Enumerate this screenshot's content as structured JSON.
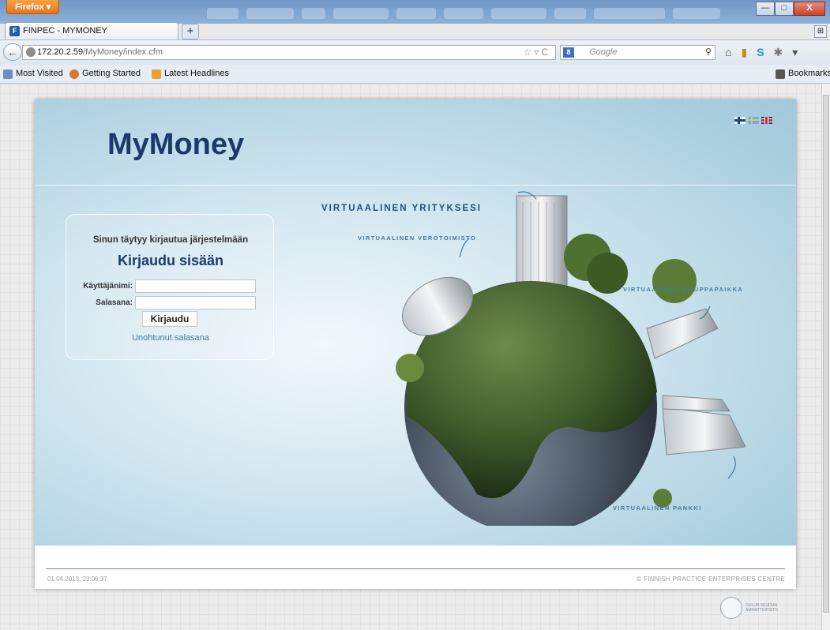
{
  "browser": {
    "app_menu": "Firefox",
    "tab_title": "FINPEC - MYMONEY",
    "tab_favicon": "F",
    "new_tab": "+",
    "url_host": "172.20.2.59",
    "url_path": "/MyMoney/index.cfm",
    "search_placeholder": "Google",
    "search_engine_icon": "8",
    "window_buttons": [
      "—",
      "□",
      "X"
    ],
    "bookmarks": [
      {
        "label": "Most Visited",
        "icon": "most-visited-icon",
        "color": "#6a8fc0"
      },
      {
        "label": "Getting Started",
        "icon": "firefox-icon",
        "color": "#e0762a"
      },
      {
        "label": "Latest Headlines",
        "icon": "rss-icon",
        "color": "#f0a030"
      }
    ],
    "bookmarks_menu": "Bookmarks"
  },
  "page": {
    "logo": "MyMoney",
    "languages": [
      "fi",
      "sv",
      "en"
    ],
    "login": {
      "notice": "Sinun täytyy kirjautua järjestelmään",
      "heading": "Kirjaudu sisään",
      "username_label": "Käyttäjänimi:",
      "username_value": "",
      "password_label": "Salasana:",
      "password_value": "",
      "submit_label": "Kirjaudu",
      "forgot_password": "Unohtunut salasana"
    },
    "taglines": {
      "company": "VIRTUAALINEN YRITYKSESI",
      "tax_office": "VIRTUAALINEN VEROTOIMISTO",
      "marketplace": "VIRTUAALINEN KAUPPAPAIKKA",
      "bank": "VIRTUAALINEN PANKKI"
    },
    "footer": {
      "datetime": "01.04.2013, 23:06:37",
      "copyright": "© FINNISH PRACTICE ENTERPRISES CENTRE"
    },
    "partner_logo_text": "OULUN SEUDUN AMMATTIOPISTO"
  },
  "colors": {
    "brand": "#1b3a6b",
    "link": "#3a7aa6",
    "hero_bg": "#b7d8e6"
  }
}
